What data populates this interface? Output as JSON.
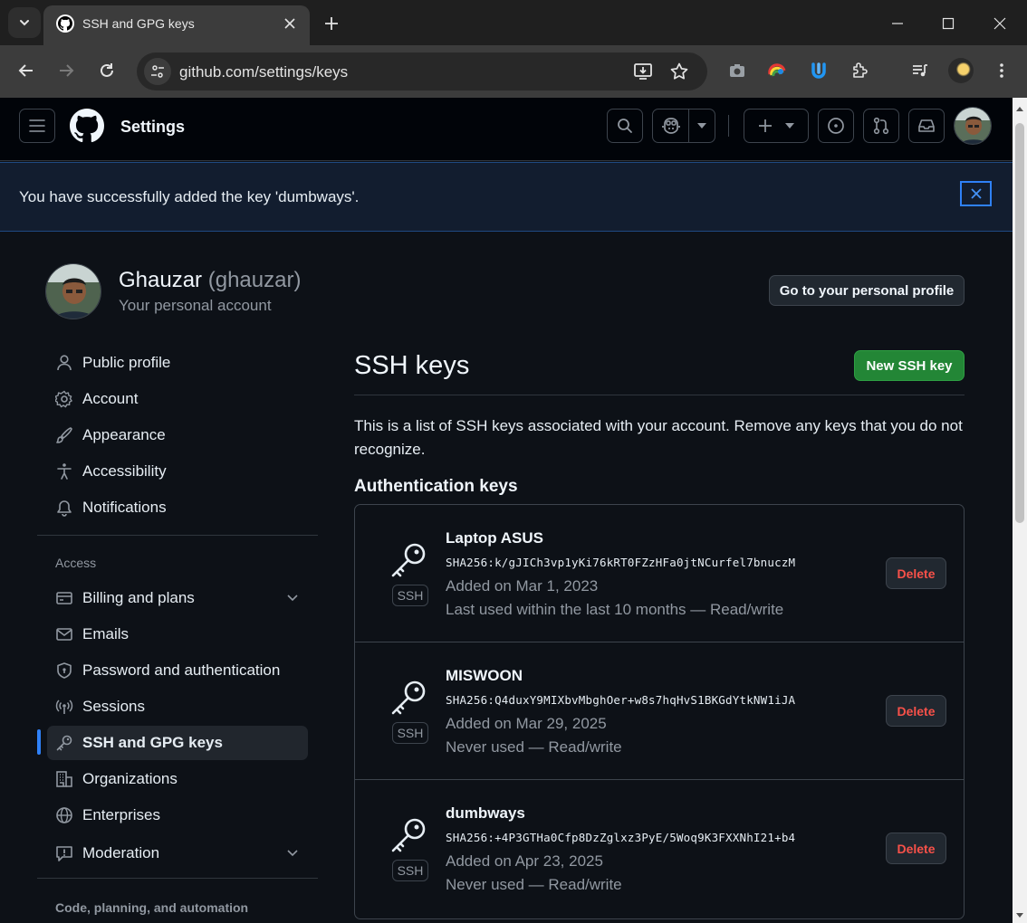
{
  "browser": {
    "tab_title": "SSH and GPG keys",
    "url": "github.com/settings/keys"
  },
  "header": {
    "title": "Settings"
  },
  "flash": {
    "message": "You have successfully added the key 'dumbways'."
  },
  "account": {
    "name": "Ghauzar",
    "handle": "(ghauzar)",
    "subtitle": "Your personal account",
    "profile_button": "Go to your personal profile"
  },
  "sidebar": {
    "items": [
      {
        "label": "Public profile",
        "icon": "person-icon"
      },
      {
        "label": "Account",
        "icon": "gear-icon"
      },
      {
        "label": "Appearance",
        "icon": "paintbrush-icon"
      },
      {
        "label": "Accessibility",
        "icon": "accessibility-icon"
      },
      {
        "label": "Notifications",
        "icon": "bell-icon"
      }
    ],
    "access_heading": "Access",
    "access_items": [
      {
        "label": "Billing and plans",
        "icon": "credit-card-icon",
        "expandable": true
      },
      {
        "label": "Emails",
        "icon": "mail-icon"
      },
      {
        "label": "Password and authentication",
        "icon": "shield-lock-icon"
      },
      {
        "label": "Sessions",
        "icon": "broadcast-icon"
      },
      {
        "label": "SSH and GPG keys",
        "icon": "key-icon",
        "active": true
      },
      {
        "label": "Organizations",
        "icon": "organization-icon"
      },
      {
        "label": "Enterprises",
        "icon": "globe-icon"
      },
      {
        "label": "Moderation",
        "icon": "report-icon",
        "expandable": true
      }
    ],
    "code_heading": "Code, planning, and automation"
  },
  "main": {
    "title": "SSH keys",
    "new_button": "New SSH key",
    "intro": "This is a list of SSH keys associated with your account. Remove any keys that you do not recognize.",
    "section_title": "Authentication keys",
    "keys": [
      {
        "name": "Laptop ASUS",
        "fingerprint": "SHA256:k/gJICh3vp1yKi76kRT0FZzHFa0jtNCurfel7bnuczM",
        "added": "Added on Mar 1, 2023",
        "usage": "Last used within the last 10 months — Read/write",
        "badge": "SSH",
        "delete_label": "Delete"
      },
      {
        "name": "MISWOON",
        "fingerprint": "SHA256:Q4duxY9MIXbvMbghOer+w8s7hqHvS1BKGdYtkNW1iJA",
        "added": "Added on Mar 29, 2025",
        "usage": "Never used — Read/write",
        "badge": "SSH",
        "delete_label": "Delete"
      },
      {
        "name": "dumbways",
        "fingerprint": "SHA256:+4P3GTHa0Cfp8DzZglxz3PyE/5Woq9K3FXXNhI21+b4",
        "added": "Added on Apr 23, 2025",
        "usage": "Never used — Read/write",
        "badge": "SSH",
        "delete_label": "Delete"
      }
    ]
  },
  "colors": {
    "accent_blue": "#2f81f7",
    "primary_green": "#238636",
    "danger_red": "#f85149",
    "page_bg": "#0d1117"
  }
}
